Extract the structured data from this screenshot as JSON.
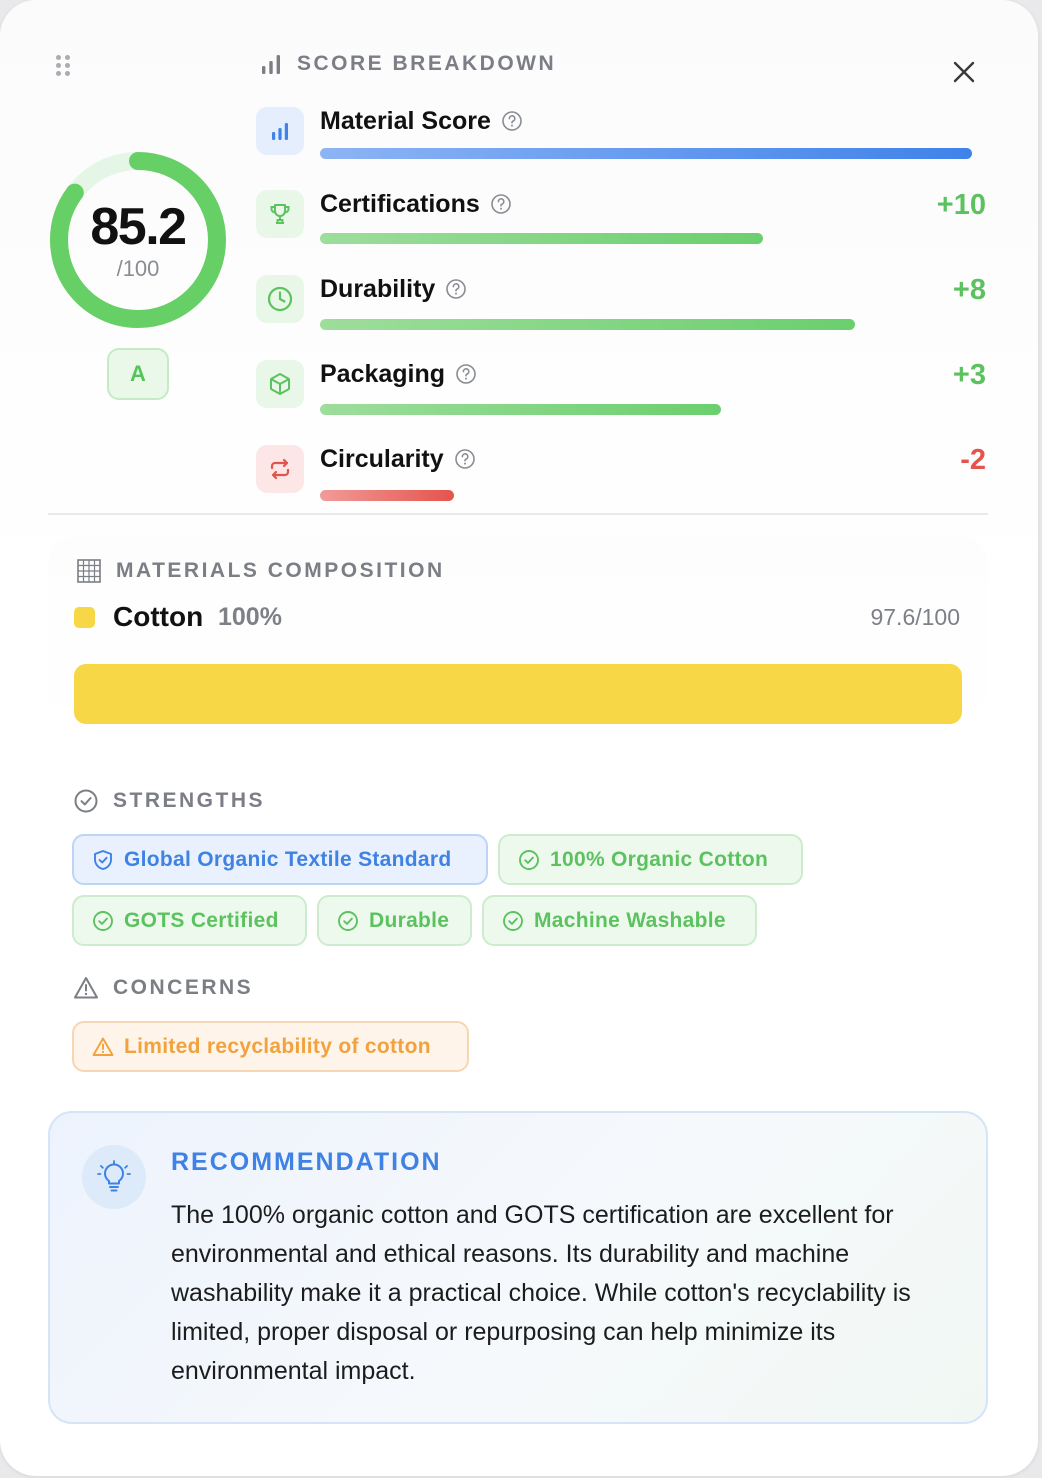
{
  "score": {
    "value": "85.2",
    "max": "/100",
    "fraction": 0.852,
    "grade": "A"
  },
  "breakdown": {
    "title": "SCORE BREAKDOWN",
    "rows": [
      {
        "label": "Material Score",
        "delta": "",
        "bar_fraction": 1.0,
        "color": "#3f82ea",
        "icon": "bar-chart-icon"
      },
      {
        "label": "Certifications",
        "delta": "+10",
        "bar_fraction": 0.68,
        "color": "#5cc25f",
        "icon": "trophy-icon"
      },
      {
        "label": "Durability",
        "delta": "+8",
        "bar_fraction": 0.82,
        "color": "#5cc25f",
        "icon": "clock-icon"
      },
      {
        "label": "Packaging",
        "delta": "+3",
        "bar_fraction": 0.615,
        "color": "#5cc25f",
        "icon": "box-icon"
      },
      {
        "label": "Circularity",
        "delta": "-2",
        "bar_fraction": 0.205,
        "color": "#e4544d",
        "icon": "repeat-icon"
      }
    ]
  },
  "materials": {
    "title": "MATERIALS COMPOSITION",
    "items": [
      {
        "name": "Cotton",
        "percent": "100%",
        "score": "97.6/100",
        "color": "#f8d746"
      }
    ]
  },
  "strengths": {
    "title": "STRENGTHS",
    "chips": [
      {
        "label": "Global Organic Textile Standard",
        "kind": "blue",
        "icon": "shield-icon"
      },
      {
        "label": "100% Organic Cotton",
        "kind": "green",
        "icon": "check-circle-icon"
      },
      {
        "label": "GOTS Certified",
        "kind": "green",
        "icon": "check-circle-icon"
      },
      {
        "label": "Durable",
        "kind": "green",
        "icon": "check-circle-icon"
      },
      {
        "label": "Machine Washable",
        "kind": "green",
        "icon": "check-circle-icon"
      }
    ]
  },
  "concerns": {
    "title": "CONCERNS",
    "chips": [
      {
        "label": "Limited recyclability of cotton",
        "kind": "orange",
        "icon": "warning-icon"
      }
    ]
  },
  "recommendation": {
    "title": "RECOMMENDATION",
    "text": "The 100% organic cotton and GOTS certification are excellent for environmental and ethical reasons. Its durability and machine washability make it a practical choice. While cotton's recyclability is limited, proper disposal or repurposing can help minimize its environmental impact."
  },
  "colors": {
    "green": "#5cc25f",
    "blue": "#3f82e4",
    "red": "#e4544d",
    "orange": "#f2a23c",
    "yellow": "#f8d746"
  }
}
